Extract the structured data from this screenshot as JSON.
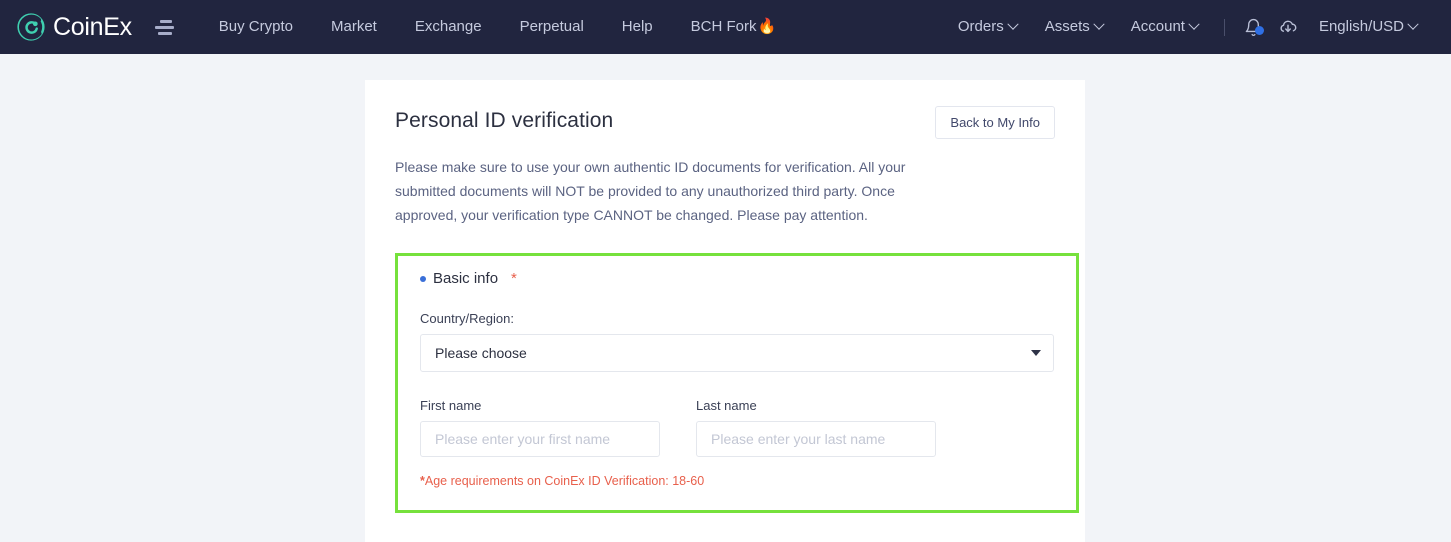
{
  "navbar": {
    "brand": "CoinEx",
    "brand_icon": "coinex-logo-icon",
    "menu_icon": "hamburger-menu-icon",
    "links": [
      {
        "label": "Buy Crypto"
      },
      {
        "label": "Market"
      },
      {
        "label": "Exchange"
      },
      {
        "label": "Perpetual"
      },
      {
        "label": "Help"
      }
    ],
    "promo": {
      "label": "BCH Fork",
      "emoji": "🔥"
    },
    "right_links": [
      {
        "label": "Orders",
        "caret": true
      },
      {
        "label": "Assets",
        "caret": true
      },
      {
        "label": "Account",
        "caret": true
      }
    ],
    "notification_icon": "bell-icon",
    "notification_badge": true,
    "download_icon": "cloud-download-icon",
    "locale": {
      "label": "English/USD",
      "caret": true
    },
    "colors": {
      "background": "#21253f",
      "text": "#c5cade",
      "badge": "#2f6fe4"
    }
  },
  "main": {
    "title": "Personal ID verification",
    "back_button": "Back to My Info",
    "description": "Please make sure to use your own authentic ID documents for verification. All your submitted documents will NOT be provided to any unauthorized third party. Once approved, your verification type CANNOT be changed. Please pay attention.",
    "basic_info": {
      "section_title": "Basic info",
      "required_marker": "*",
      "highlight_color": "#76e13c",
      "bullet_color": "#3a6fd8",
      "country_label": "Country/Region:",
      "country_value": "Please choose",
      "first_name_label": "First name",
      "first_name_value": "",
      "first_name_placeholder": "Please enter your first name",
      "last_name_label": "Last name",
      "last_name_value": "",
      "last_name_placeholder": "Please enter your last name",
      "age_note_star": "*",
      "age_note": "Age requirements on CoinEx ID Verification: 18-60",
      "age_note_color": "#e8604c"
    }
  }
}
